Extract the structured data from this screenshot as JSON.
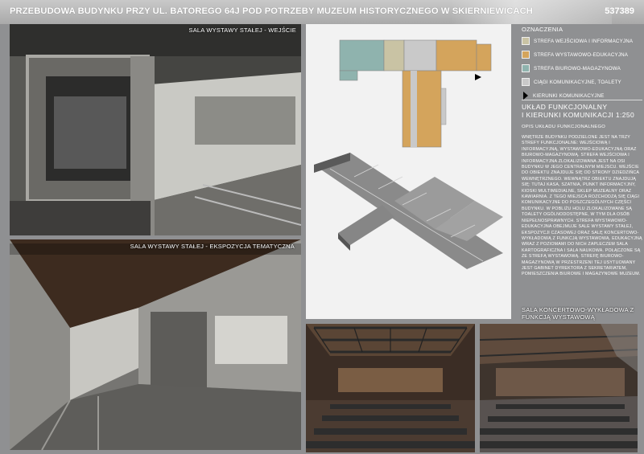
{
  "header": {
    "title": "PRZEBUDOWA BUDYNKU PRZY UL. BATOREGO 64J POD POTRZEBY MUZEUM HISTORYCZNEGO W SKIERNIEWICACH",
    "code": "537389"
  },
  "nav_dots": [
    {
      "state": "inactive"
    },
    {
      "state": "inactive"
    },
    {
      "state": "inactive"
    },
    {
      "state": "active"
    }
  ],
  "colors": {
    "active_dot": "#c8161d",
    "zone_entrance": "#c9c3a4",
    "zone_exhibition": "#d4a45c",
    "zone_office": "#8fb3ae",
    "zone_communication": "#c9c9c9"
  },
  "captions": {
    "entrance": "SALA WYSTAWY STAŁEJ - WEJŚCIE",
    "exhibit": "SALA WYSTAWY STAŁEJ - EKSPOZYCJA TEMATYCZNA",
    "concert": "SALA KONCERTOWO-WYKŁADOWA Z FUNKCJĄ WYSTAWOWĄ"
  },
  "legend": {
    "heading": "OZNACZENIA",
    "items": [
      {
        "label": "STREFA WEJŚCIOWA I INFORMACYJNA",
        "color": "#c9c3a4"
      },
      {
        "label": "STREFA WYSTAWOWO-EDUKACYJNA",
        "color": "#d4a45c"
      },
      {
        "label": "STREFA BIUROWO-MAGAZYNOWA",
        "color": "#8fb3ae"
      },
      {
        "label": "CIĄGI KOMUNIKACYJNE, TOALETY",
        "color": "#c9c9c9"
      },
      {
        "label": "KIERUNKI KOMUNIKACYJNE",
        "icon": "arrow-icon"
      }
    ]
  },
  "layout_section": {
    "title_line1": "UKŁAD FUNKCJONALNY",
    "title_line2": "I KIERUNKI KOMUNIKACJI 1:250"
  },
  "description": {
    "heading": "OPIS UKŁADU FUNKCJONALNEGO",
    "text": "WNĘTRZE BUDYNKU PODZIELONE JEST NA TRZY STREFY FUNKCJONALNE: WEJŚCIOWĄ I INFORMACYJNĄ, WYSTAWOWO-EDUKACYJNĄ ORAZ BIUROWO-MAGAZYNOWĄ. STREFA WEJŚCIOWA I INFORMACYJNA ZLOKALIZOWANA JEST NA OSI BUDYNKU W JEGO CENTRALNYM MIEJSCU. WEJŚCIE DO OBIEKTU ZNAJDUJE SIĘ OD STRONY DZIEDZIŃCA WEWNĘTRZNEGO. WEWNĄTRZ OBIEKTU ZNAJDUJĄ SIĘ: TUTAJ KASA, SZATNIA, PUNKT INFORMACYJNY, KIOSKI MULTIMEDIALNE, SKLEP MUZEALNY ORAZ KAWIARNIA. Z TEGO MIEJSCA ROZCHODZĄ SIĘ CIĄGI KOMUNIKACYJNE DO POSZCZEGÓLNYCH CZĘŚCI BUDYNKU. W POBLIŻU HOLU ZLOKALIZOWANE SĄ TOALETY OGÓLNODOSTĘPNE, W TYM DLA OSÓB NIEPEŁNOSPRAWNYCH. STREFA WYSTAWOWO-EDUKACYJNA OBEJMUJE SALE WYSTAWY STAŁEJ, EKSPOZYCJI CZASOWEJ ORAZ SALĘ KONCERTOWO-WYKŁADOWĄ Z FUNKCJĄ WYSTAWOWĄ. EDUKACYJNĄ WRAZ Z POZIOMAMI DO NICH ZAPLECZEM SALA KARTOGRAFICZNA I SALA NAUKOWA. POŁĄCZONE SĄ ZE STREFĄ WYSTAWOWĄ. STREFĘ BIUROWO-MAGAZYNOWĄ W PRZESTRZENI TEJ USYTUOWANY JEST GABINET DYREKTORA Z SEKRETARIATEM, POMIESZCZENIA BIUROWE I MAGAZYNOWE MUZEUM."
  }
}
